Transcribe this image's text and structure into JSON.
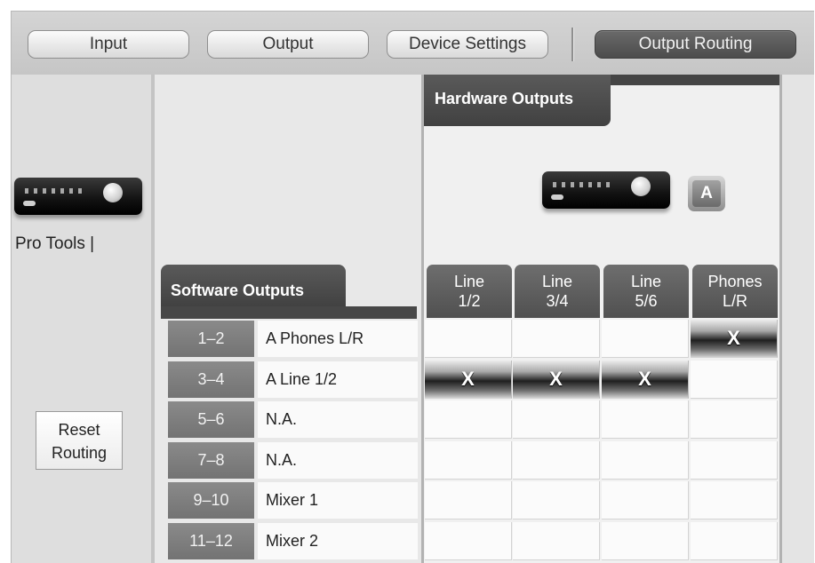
{
  "tabs": [
    {
      "label": "Input",
      "active": false
    },
    {
      "label": "Output",
      "active": false
    },
    {
      "label": "Device Settings",
      "active": false
    },
    {
      "label": "Output Routing",
      "active": true
    }
  ],
  "left_panel": {
    "device_label": "Pro Tools |",
    "reset_button": [
      "Reset",
      "Routing"
    ]
  },
  "software_outputs": {
    "title": "Software Outputs",
    "rows": [
      {
        "channels": "1–2",
        "name": "A Phones L/R"
      },
      {
        "channels": "3–4",
        "name": "A Line 1/2"
      },
      {
        "channels": "5–6",
        "name": "N.A."
      },
      {
        "channels": "7–8",
        "name": "N.A."
      },
      {
        "channels": "9–10",
        "name": "Mixer 1"
      },
      {
        "channels": "11–12",
        "name": "Mixer 2"
      }
    ]
  },
  "hardware_outputs": {
    "title": "Hardware Outputs",
    "bank": "A",
    "columns": [
      {
        "line1": "Line",
        "line2": "1/2"
      },
      {
        "line1": "Line",
        "line2": "3/4"
      },
      {
        "line1": "Line",
        "line2": "5/6"
      },
      {
        "line1": "Phones",
        "line2": "L/R"
      }
    ]
  },
  "routing_mark": "X",
  "routing": [
    [
      false,
      false,
      false,
      true
    ],
    [
      true,
      true,
      true,
      false
    ],
    [
      false,
      false,
      false,
      false
    ],
    [
      false,
      false,
      false,
      false
    ],
    [
      false,
      false,
      false,
      false
    ],
    [
      false,
      false,
      false,
      false
    ]
  ],
  "colors": {
    "header_dark": "#474747",
    "active_tab": "#555555",
    "row_number_bg": "#7d7d7d"
  }
}
